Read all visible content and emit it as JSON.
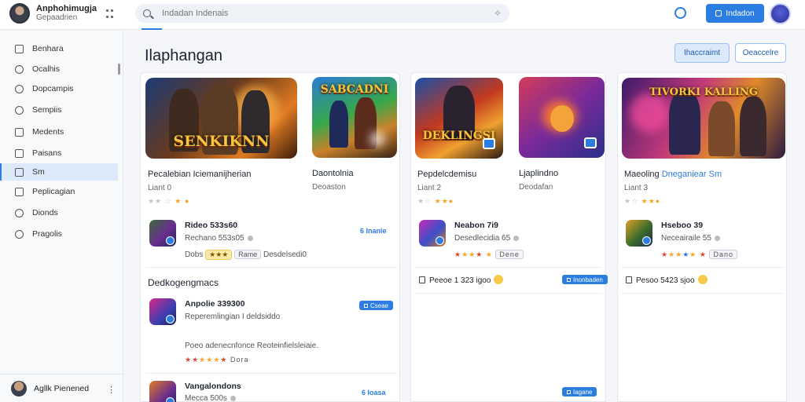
{
  "header": {
    "brand_title": "Anphohimugja",
    "brand_sub": "Gepaadrien",
    "search_placeholder": "Indadan Indenais",
    "top_button": "Indadon"
  },
  "sidebar": {
    "items": [
      {
        "label": "Benhara",
        "icon": "square-icon"
      },
      {
        "label": "Ocalhis",
        "icon": "circle-icon"
      },
      {
        "label": "Dopcampis",
        "icon": "circle-icon"
      },
      {
        "label": "Sempiis",
        "icon": "chat-icon"
      },
      {
        "label": "Medents",
        "icon": "square-icon"
      },
      {
        "label": "Paisans",
        "icon": "doc-icon"
      },
      {
        "label": "Sm",
        "icon": "square-icon"
      },
      {
        "label": "Peplicagian",
        "icon": "square-icon"
      },
      {
        "label": "Dionds",
        "icon": "circle-icon"
      },
      {
        "label": "Pragolis",
        "icon": "circle-icon"
      }
    ],
    "active_index": 6,
    "user_name": "Agllk Pienened"
  },
  "main": {
    "title": "Ilaphangan",
    "btn_primary": "Ihaccraimt",
    "btn_secondary": "Oeaccelre"
  },
  "cards": [
    {
      "art_title": "SENKIKNN",
      "title": "Pecalebian Iciemanijherian",
      "sub": "Liant 0",
      "row_name": "Rideo 533s60",
      "row_meta": "Rechano 553s05",
      "row_chip1": "Dobs",
      "row_chip2": "Rame",
      "row_tail": "Desdelsedi0",
      "row_link": "6 Inanie"
    },
    {
      "art_title": "SABCADNI",
      "title": "Daontolnia",
      "sub": "Deoaston"
    },
    {
      "art_title": "DEKLINGSI",
      "title": "Pepdelcdemisu",
      "sub": "Liant 2",
      "row_name": "Neabon 7i9",
      "row_meta": "Desedlecidia 65",
      "row_chip": "Dene",
      "foot_text": "Peeoe 1 323 igoo",
      "foot_pill": "Inonbaden"
    },
    {
      "art_title": "",
      "title": "Ljaplindno",
      "sub": "Deodafan"
    },
    {
      "art_title": "TIVORKI KALLING",
      "title_a": "Maeoling",
      "title_b": "Dneganiear Sm",
      "sub": "Liant 3",
      "row_name": "Hseboo 39",
      "row_meta": "Neceairaile 55",
      "row_chip": "Dano",
      "foot_text": "Pesoo 5423 sjoo",
      "foot_pill": ""
    }
  ],
  "list_section": {
    "title": "Dedkogengmacs",
    "items": [
      {
        "name": "Anpolie 339300",
        "sub": "Reperemlingian I deldsiddo",
        "desc": "Poeo adenecnfonce Reoteinfielsleiaie.",
        "tag": "Dora",
        "pill": "Cseae"
      },
      {
        "name": "Vangalondons",
        "sub": "Mecca 500s",
        "pill": "6 Ioasa"
      }
    ],
    "footer_link": "Iagane"
  },
  "colors": {
    "accent": "#2b7de1",
    "star": "#f5a623",
    "background": "#f4f6f9"
  }
}
